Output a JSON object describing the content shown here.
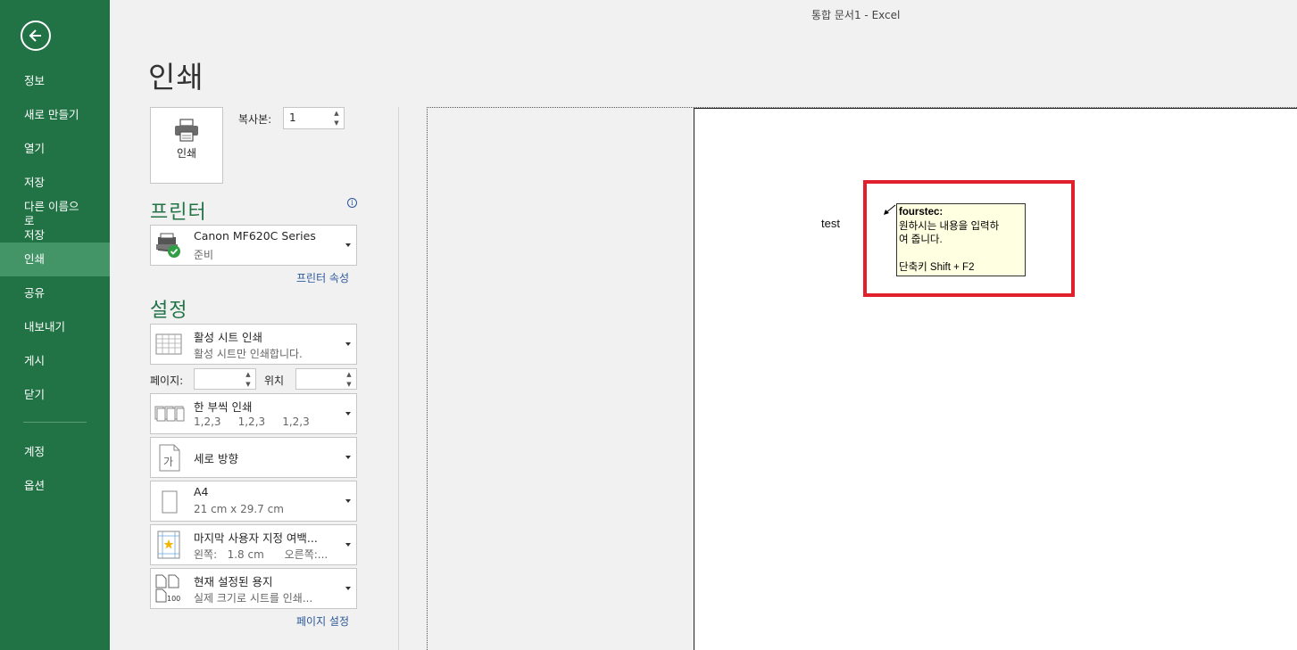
{
  "window": {
    "title": "통합 문서1 - Excel"
  },
  "sidebar": {
    "items": [
      {
        "label": "정보"
      },
      {
        "label": "새로 만들기"
      },
      {
        "label": "열기"
      },
      {
        "label": "저장"
      },
      {
        "label": "다른 이름으로\n저장"
      },
      {
        "label": "인쇄",
        "active": true
      },
      {
        "label": "공유"
      },
      {
        "label": "내보내기"
      },
      {
        "label": "게시"
      },
      {
        "label": "닫기"
      }
    ],
    "bottom_items": [
      {
        "label": "계정"
      },
      {
        "label": "옵션"
      }
    ]
  },
  "page": {
    "title": "인쇄"
  },
  "print": {
    "button_label": "인쇄",
    "copies_label": "복사본:",
    "copies_value": "1"
  },
  "printer": {
    "heading": "프린터",
    "name": "Canon MF620C Series",
    "status": "준비",
    "properties_link": "프린터 속성"
  },
  "settings": {
    "heading": "설정",
    "what": {
      "main": "활성 시트 인쇄",
      "sub": "활성 시트만 인쇄합니다."
    },
    "pages_label": "페이지:",
    "pages_value": "",
    "to_label": "위치",
    "to_value": "",
    "collate": {
      "main": "한 부씩 인쇄",
      "sub": "1,2,3     1,2,3     1,2,3"
    },
    "orientation": {
      "main": "세로 방향"
    },
    "paper": {
      "main": "A4",
      "sub": "21 cm x 29.7 cm"
    },
    "margins": {
      "main": "마지막 사용자 지정 여백...",
      "sub": "왼쪽:   1.8 cm      오른쪽:..."
    },
    "scaling": {
      "main": "현재 설정된 용지",
      "sub": "실제 크기로 시트를 인쇄..."
    },
    "page_setup_link": "페이지 설정"
  },
  "preview": {
    "cell_text": "test",
    "comment": {
      "author": "fourstec:",
      "line1": "원하시는 내용을 입력하",
      "line2": "여 줍니다.",
      "line3": "단축키 Shift + F2"
    }
  },
  "colors": {
    "sidebar_bg": "#217346",
    "sidebar_active": "#439467",
    "accent_green": "#217346",
    "link_blue": "#2b579a",
    "highlight_red": "#e0202c",
    "comment_bg": "#ffffe1"
  }
}
